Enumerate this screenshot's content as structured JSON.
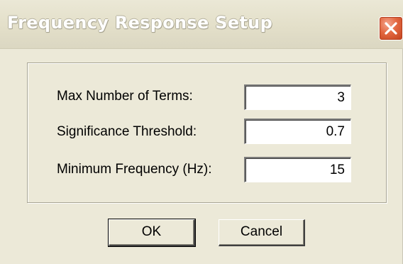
{
  "window": {
    "title": "Frequency Response Setup",
    "close_icon": "close-icon"
  },
  "form": {
    "max_terms": {
      "label": "Max Number of Terms:",
      "value": "3"
    },
    "significance_threshold": {
      "label": "Significance Threshold:",
      "value": "0.7"
    },
    "min_frequency": {
      "label": "Minimum Frequency (Hz):",
      "value": "15"
    }
  },
  "buttons": {
    "ok_label": "OK",
    "cancel_label": "Cancel"
  },
  "colors": {
    "dialog_background": "#ece9d8",
    "close_button": "#e2663f"
  }
}
